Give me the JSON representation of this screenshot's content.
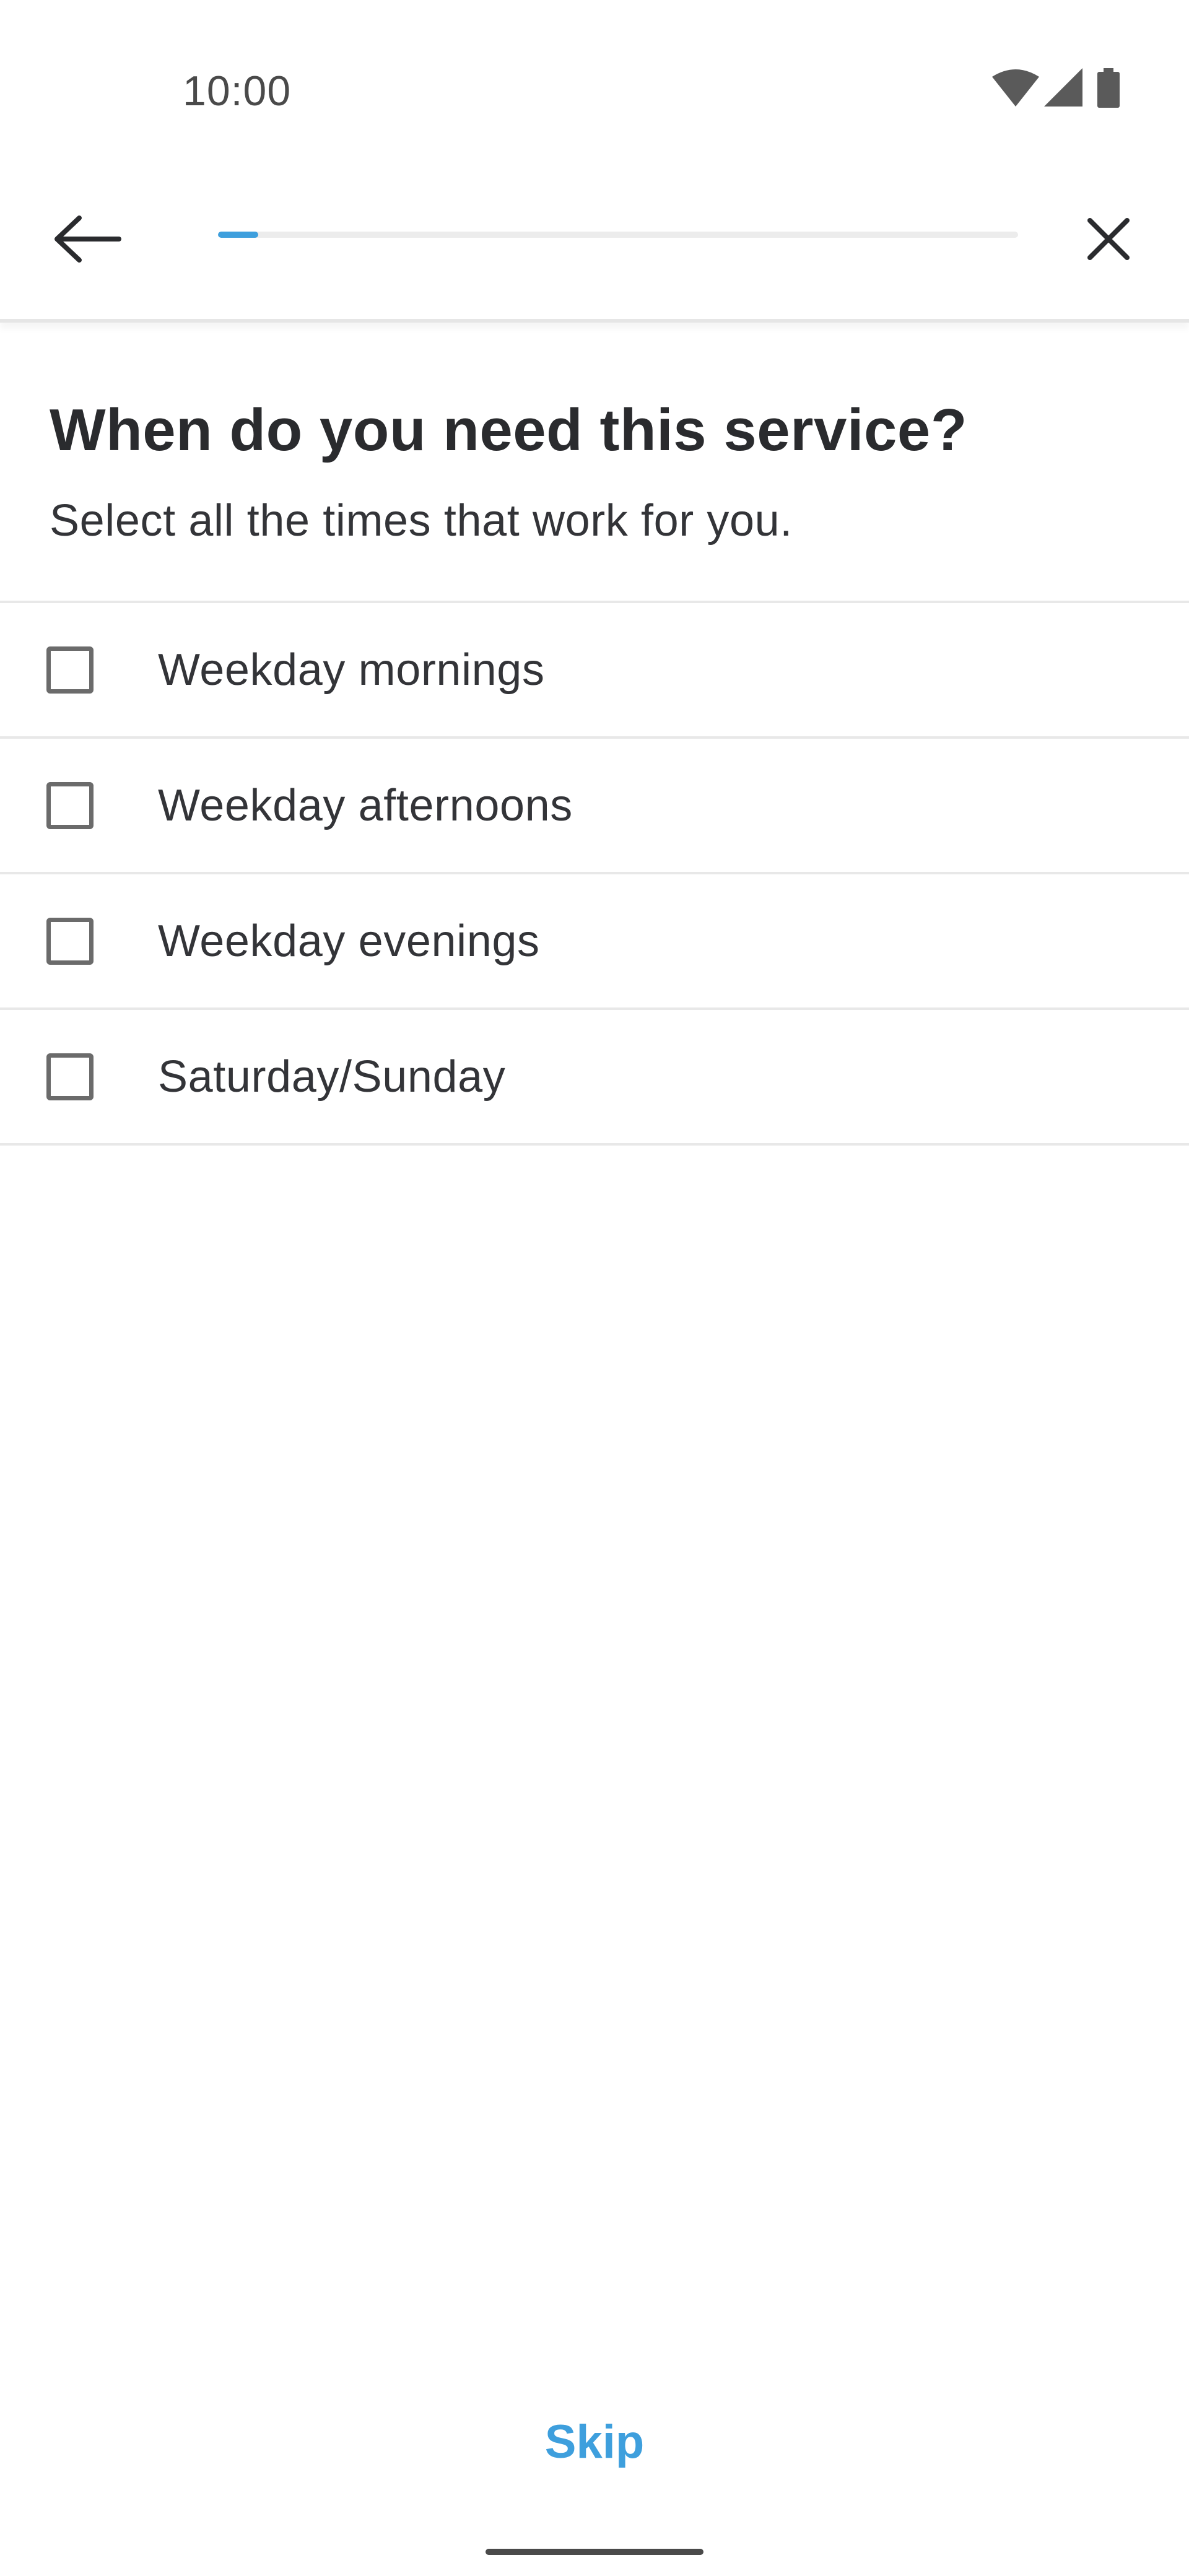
{
  "status_bar": {
    "time": "10:00",
    "icons": [
      "wifi-icon",
      "cellular-signal-icon",
      "battery-icon"
    ]
  },
  "app_bar": {
    "back_icon": "arrow-left-icon",
    "close_icon": "close-icon",
    "progress_fraction": 0.05
  },
  "main": {
    "question": "When do you need this service?",
    "subtitle": "Select all the times that work for you.",
    "options": [
      {
        "label": "Weekday mornings",
        "checked": false
      },
      {
        "label": "Weekday afternoons",
        "checked": false
      },
      {
        "label": "Weekday evenings",
        "checked": false
      },
      {
        "label": "Saturday/Sunday",
        "checked": false
      }
    ]
  },
  "footer": {
    "skip_label": "Skip"
  },
  "colors": {
    "accent": "#3e9fdd",
    "text": "#2f3033",
    "divider": "#e8e8e8"
  }
}
